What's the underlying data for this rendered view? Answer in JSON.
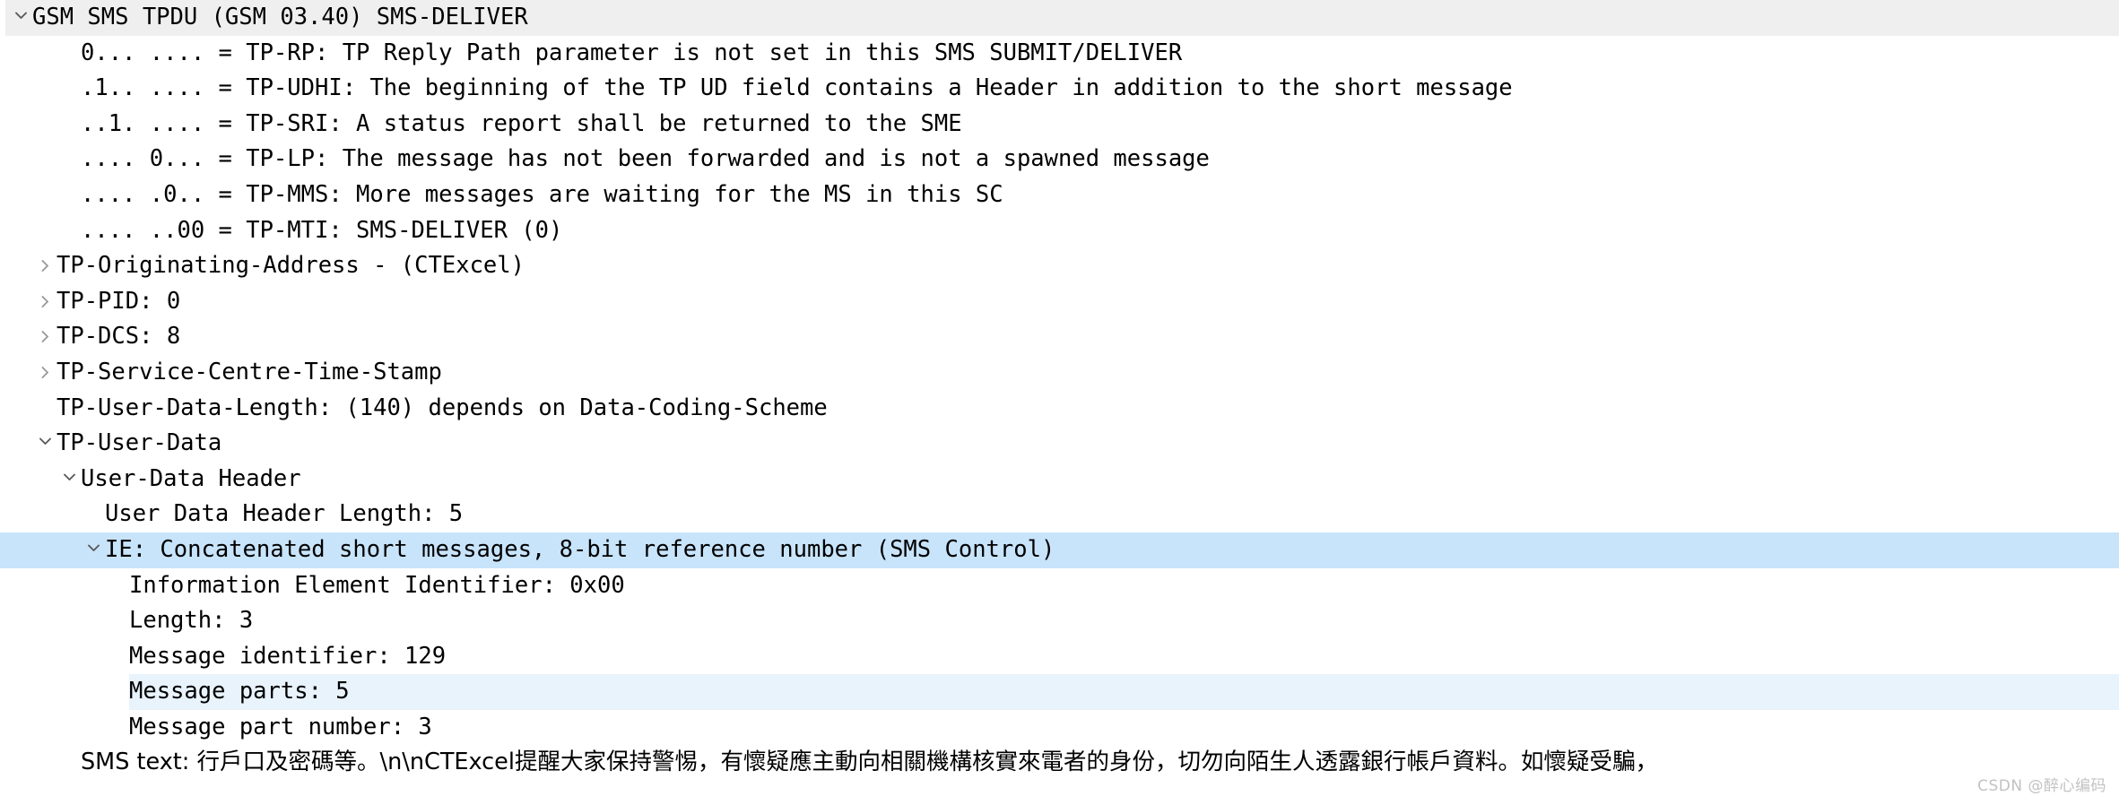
{
  "app": {
    "pane_name": "packet-details",
    "colors": {
      "background": "#ffffff",
      "text": "#000000",
      "selected_row": "#c8e4fb",
      "hover_row": "#efefef",
      "related_row": "#e8f3fc",
      "twisty": "#5a5a5a",
      "watermark": "#c2c2c2"
    }
  },
  "watermark": {
    "text": "CSDN @醉心编码"
  },
  "tree": {
    "rows": [
      {
        "id": "gsm-sms-tpdu",
        "depth": 0,
        "twisty": "expanded",
        "highlight": "gray",
        "label": "GSM SMS TPDU (GSM 03.40) SMS-DELIVER"
      },
      {
        "id": "tp-rp",
        "depth": 2,
        "twisty": "none",
        "highlight": "none",
        "label": "0... .... = TP-RP: TP Reply Path parameter is not set in this SMS SUBMIT/DELIVER"
      },
      {
        "id": "tp-udhi",
        "depth": 2,
        "twisty": "none",
        "highlight": "none",
        "label": ".1.. .... = TP-UDHI: The beginning of the TP UD field contains a Header in addition to the short message"
      },
      {
        "id": "tp-sri",
        "depth": 2,
        "twisty": "none",
        "highlight": "none",
        "label": "..1. .... = TP-SRI: A status report shall be returned to the SME"
      },
      {
        "id": "tp-lp",
        "depth": 2,
        "twisty": "none",
        "highlight": "none",
        "label": ".... 0... = TP-LP: The message has not been forwarded and is not a spawned message"
      },
      {
        "id": "tp-mms",
        "depth": 2,
        "twisty": "none",
        "highlight": "none",
        "label": ".... .0.. = TP-MMS: More messages are waiting for the MS in this SC"
      },
      {
        "id": "tp-mti",
        "depth": 2,
        "twisty": "none",
        "highlight": "none",
        "label": ".... ..00 = TP-MTI: SMS-DELIVER (0)"
      },
      {
        "id": "tp-originating-address",
        "depth": 1,
        "twisty": "collapsed",
        "highlight": "none",
        "label": "TP-Originating-Address - (CTExcel)"
      },
      {
        "id": "tp-pid",
        "depth": 1,
        "twisty": "collapsed",
        "highlight": "none",
        "label": "TP-PID: 0"
      },
      {
        "id": "tp-dcs",
        "depth": 1,
        "twisty": "collapsed",
        "highlight": "none",
        "label": "TP-DCS: 8"
      },
      {
        "id": "tp-service-centre-time-stamp",
        "depth": 1,
        "twisty": "collapsed",
        "highlight": "none",
        "label": "TP-Service-Centre-Time-Stamp"
      },
      {
        "id": "tp-user-data-length",
        "depth": 1,
        "twisty": "none",
        "highlight": "none",
        "label": "TP-User-Data-Length: (140) depends on Data-Coding-Scheme"
      },
      {
        "id": "tp-user-data",
        "depth": 1,
        "twisty": "expanded",
        "highlight": "none",
        "label": "TP-User-Data"
      },
      {
        "id": "user-data-header",
        "depth": 2,
        "twisty": "expanded",
        "highlight": "none",
        "label": "User-Data Header"
      },
      {
        "id": "user-data-header-length",
        "depth": 3,
        "twisty": "none",
        "highlight": "none",
        "label": "User Data Header Length: 5"
      },
      {
        "id": "ie-concatenated-short-messages",
        "depth": 3,
        "twisty": "expanded",
        "highlight": "blue",
        "label": "IE: Concatenated short messages, 8-bit reference number (SMS Control)"
      },
      {
        "id": "information-element-identifier",
        "depth": 4,
        "twisty": "none",
        "highlight": "none",
        "label": "Information Element Identifier: 0x00"
      },
      {
        "id": "length",
        "depth": 4,
        "twisty": "none",
        "highlight": "none",
        "label": "Length: 3"
      },
      {
        "id": "message-identifier",
        "depth": 4,
        "twisty": "none",
        "highlight": "none",
        "label": "Message identifier: 129"
      },
      {
        "id": "message-parts",
        "depth": 4,
        "twisty": "none",
        "highlight": "faint",
        "label": "Message parts: 5"
      },
      {
        "id": "message-part-number",
        "depth": 4,
        "twisty": "none",
        "highlight": "none",
        "label": "Message part number: 3"
      },
      {
        "id": "sms-text",
        "depth": 2,
        "twisty": "none",
        "highlight": "none",
        "cjk": true,
        "label": "SMS text: 行戶口及密碼等。\\n\\nCTExcel提醒大家保持警惕，有懷疑應主動向相關機構核實來電者的身份，切勿向陌生人透露銀行帳戶資料。如懷疑受騙，"
      }
    ]
  }
}
